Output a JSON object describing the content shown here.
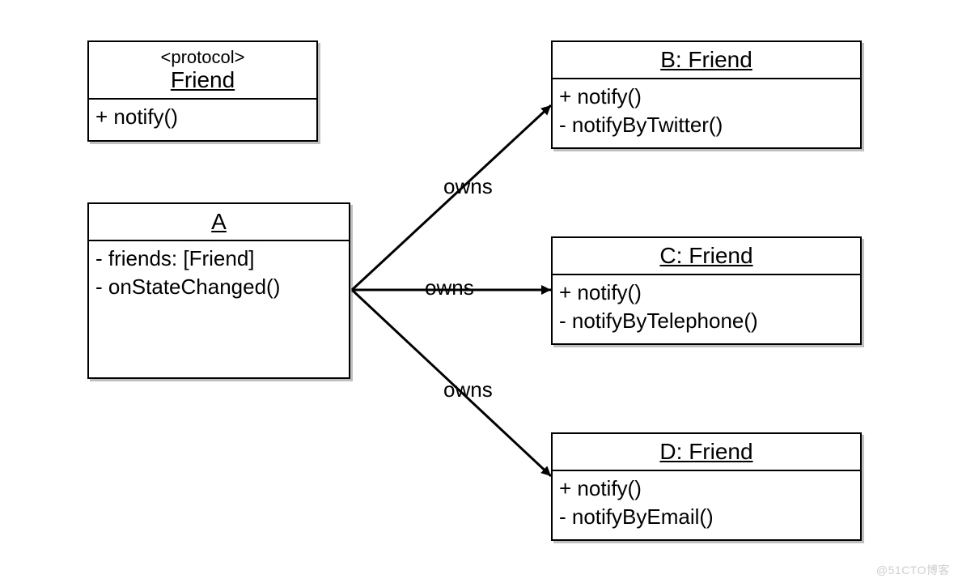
{
  "classes": {
    "friend_protocol": {
      "stereotype": "<protocol>",
      "name": "Friend",
      "members": [
        "+ notify()"
      ]
    },
    "a": {
      "name": "A",
      "members": [
        "- friends: [Friend]",
        "- onStateChanged()"
      ]
    },
    "b": {
      "name": "B: Friend",
      "members": [
        "+ notify()",
        "- notifyByTwitter()"
      ]
    },
    "c": {
      "name": "C: Friend",
      "members": [
        "+ notify()",
        "- notifyByTelephone()"
      ]
    },
    "d": {
      "name": "D: Friend",
      "members": [
        "+ notify()",
        "- notifyByEmail()"
      ]
    }
  },
  "relations": {
    "owns1": "owns",
    "owns2": "owns",
    "owns3": "owns"
  },
  "watermark": "@51CTO博客"
}
